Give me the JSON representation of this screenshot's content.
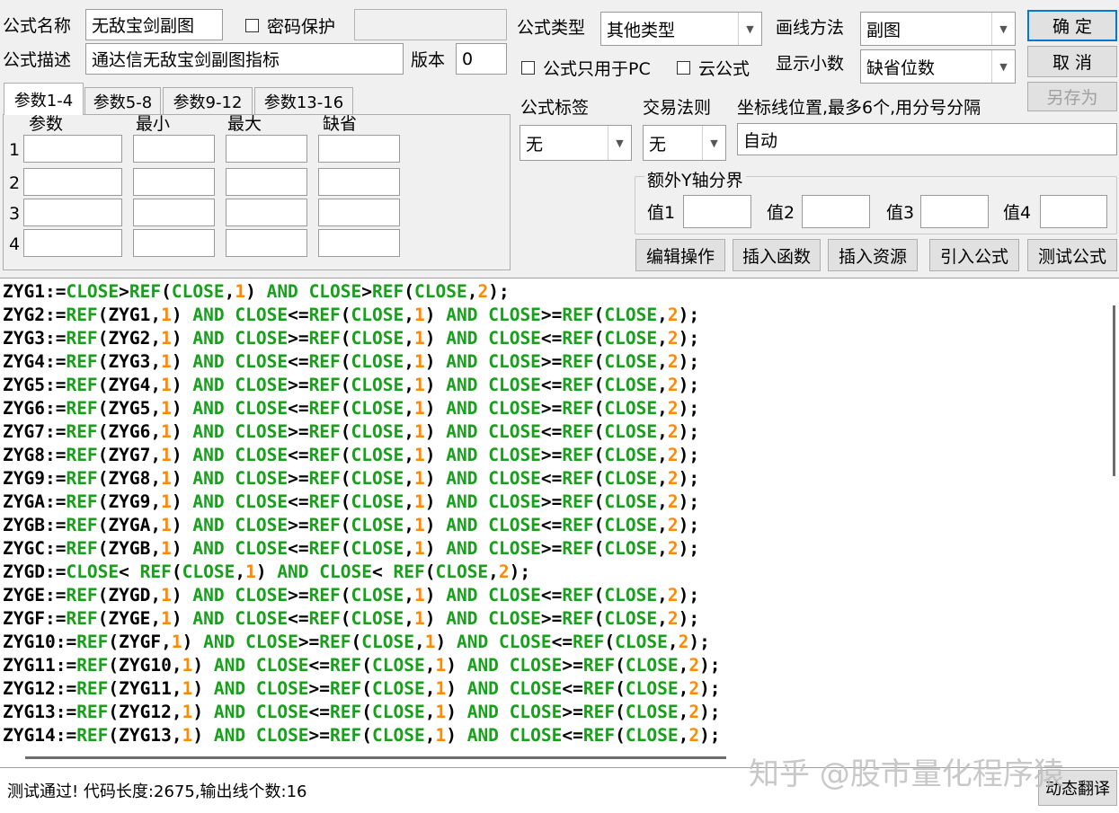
{
  "formula": {
    "name_label": "公式名称",
    "name_value": "无敌宝剑副图",
    "password_label": "密码保护",
    "password_value": "",
    "desc_label": "公式描述",
    "desc_value": "通达信无敌宝剑副图指标",
    "version_label": "版本",
    "version_value": "0"
  },
  "options": {
    "type_label": "公式类型",
    "type_value": "其他类型",
    "draw_label": "画线方法",
    "draw_value": "副图",
    "pc_only_label": "公式只用于PC",
    "cloud_label": "云公式",
    "decimal_label": "显示小数",
    "decimal_value": "缺省位数",
    "tag_label": "公式标签",
    "tag_value": "无",
    "trade_label": "交易法则",
    "trade_value": "无",
    "coord_label": "坐标线位置,最多6个,用分号分隔",
    "coord_value": "自动",
    "extra_y_label": "额外Y轴分界",
    "val_labels": [
      "值1",
      "值2",
      "值3",
      "值4"
    ]
  },
  "buttons": {
    "ok": "确  定",
    "cancel": "取  消",
    "save_as": "另存为",
    "edit": "编辑操作",
    "insert_func": "插入函数",
    "insert_res": "插入资源",
    "import": "引入公式",
    "test": "测试公式",
    "translate": "动态翻译"
  },
  "params": {
    "tabs": [
      "参数1-4",
      "参数5-8",
      "参数9-12",
      "参数13-16"
    ],
    "headers": [
      "参数",
      "最小",
      "最大",
      "缺省"
    ],
    "rows": [
      "1",
      "2",
      "3",
      "4"
    ]
  },
  "code_lines": [
    "ZYG1:=CLOSE>REF(CLOSE,1) AND CLOSE>REF(CLOSE,2);",
    "ZYG2:=REF(ZYG1,1) AND CLOSE<=REF(CLOSE,1) AND CLOSE>=REF(CLOSE,2);",
    "ZYG3:=REF(ZYG2,1) AND CLOSE>=REF(CLOSE,1) AND CLOSE<=REF(CLOSE,2);",
    "ZYG4:=REF(ZYG3,1) AND CLOSE<=REF(CLOSE,1) AND CLOSE>=REF(CLOSE,2);",
    "ZYG5:=REF(ZYG4,1) AND CLOSE>=REF(CLOSE,1) AND CLOSE<=REF(CLOSE,2);",
    "ZYG6:=REF(ZYG5,1) AND CLOSE<=REF(CLOSE,1) AND CLOSE>=REF(CLOSE,2);",
    "ZYG7:=REF(ZYG6,1) AND CLOSE>=REF(CLOSE,1) AND CLOSE<=REF(CLOSE,2);",
    "ZYG8:=REF(ZYG7,1) AND CLOSE<=REF(CLOSE,1) AND CLOSE>=REF(CLOSE,2);",
    "ZYG9:=REF(ZYG8,1) AND CLOSE>=REF(CLOSE,1) AND CLOSE<=REF(CLOSE,2);",
    "ZYGA:=REF(ZYG9,1) AND CLOSE<=REF(CLOSE,1) AND CLOSE>=REF(CLOSE,2);",
    "ZYGB:=REF(ZYGA,1) AND CLOSE>=REF(CLOSE,1) AND CLOSE<=REF(CLOSE,2);",
    "ZYGC:=REF(ZYGB,1) AND CLOSE<=REF(CLOSE,1) AND CLOSE>=REF(CLOSE,2);",
    "ZYGD:=CLOSE< REF(CLOSE,1) AND CLOSE< REF(CLOSE,2);",
    "ZYGE:=REF(ZYGD,1) AND CLOSE>=REF(CLOSE,1) AND CLOSE<=REF(CLOSE,2);",
    "ZYGF:=REF(ZYGE,1) AND CLOSE<=REF(CLOSE,1) AND CLOSE>=REF(CLOSE,2);",
    "ZYG10:=REF(ZYGF,1) AND CLOSE>=REF(CLOSE,1) AND CLOSE<=REF(CLOSE,2);",
    "ZYG11:=REF(ZYG10,1) AND CLOSE<=REF(CLOSE,1) AND CLOSE>=REF(CLOSE,2);",
    "ZYG12:=REF(ZYG11,1) AND CLOSE>=REF(CLOSE,1) AND CLOSE<=REF(CLOSE,2);",
    "ZYG13:=REF(ZYG12,1) AND CLOSE<=REF(CLOSE,1) AND CLOSE>=REF(CLOSE,2);",
    "ZYG14:=REF(ZYG13,1) AND CLOSE>=REF(CLOSE,1) AND CLOSE<=REF(CLOSE,2);"
  ],
  "status": "测试通过! 代码长度:2675,输出线个数:16",
  "watermark": "知乎 @股市量化程序猿",
  "colors": {
    "keyword": "#000000",
    "function": "#17a11b",
    "number": "#ff8a00",
    "accent": "#0078d7"
  }
}
